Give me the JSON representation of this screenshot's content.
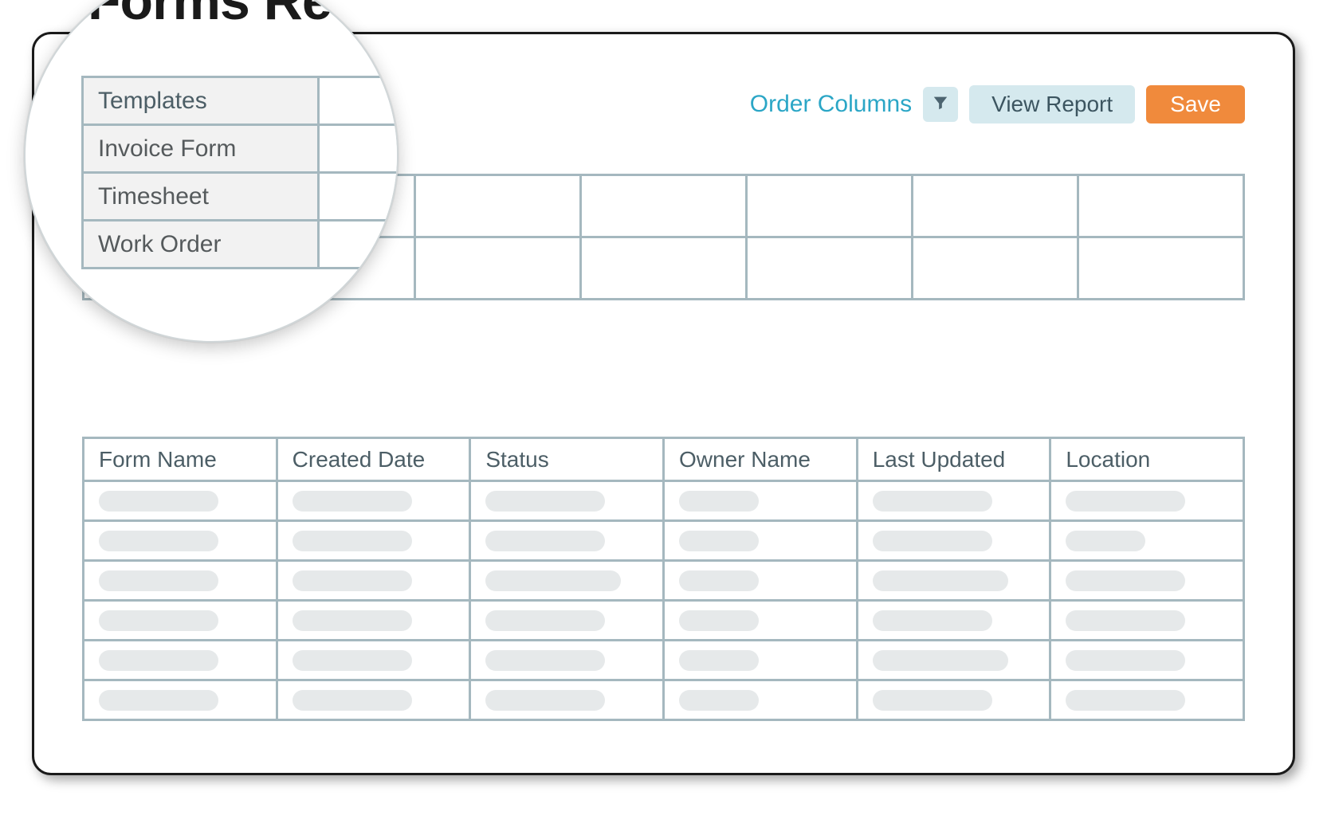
{
  "page_title": "Forms Re",
  "magnifier_title": "Forms Re",
  "toolbar": {
    "order_columns": "Order Columns",
    "view_report": "View Report",
    "save": "Save"
  },
  "templates": {
    "header": "Templates",
    "items": [
      "Invoice Form",
      "Timesheet",
      "Work Order"
    ]
  },
  "upper_table": {
    "rows": 2,
    "cols": 7
  },
  "lower_table": {
    "headers": [
      "Form Name",
      "Created Date",
      "Status",
      "Owner Name",
      "Last Updated",
      "Location"
    ],
    "rows": [
      [
        "m",
        "m",
        "m",
        "s",
        "m",
        "m"
      ],
      [
        "m",
        "m",
        "m",
        "s",
        "m",
        "s"
      ],
      [
        "m",
        "m",
        "l",
        "s",
        "l",
        "m"
      ],
      [
        "m",
        "m",
        "m",
        "s",
        "m",
        "m"
      ],
      [
        "m",
        "m",
        "m",
        "s",
        "l",
        "m"
      ],
      [
        "m",
        "m",
        "m",
        "s",
        "m",
        "m"
      ]
    ]
  }
}
